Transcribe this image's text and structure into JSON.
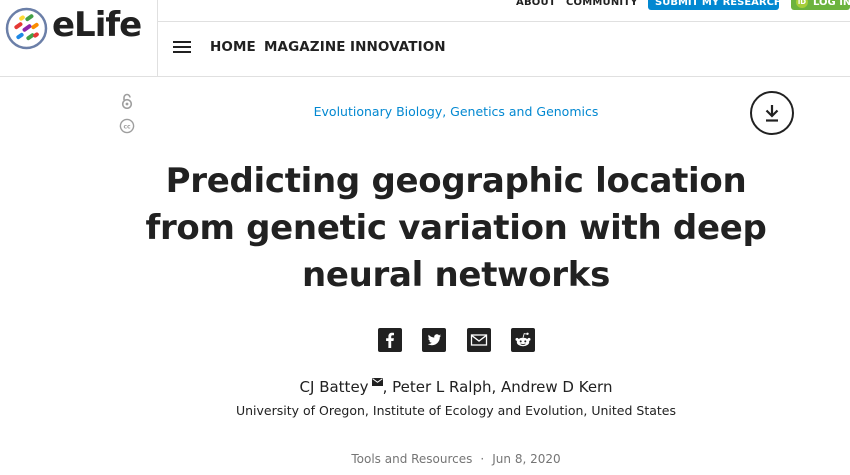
{
  "brand": {
    "logo_text": "eLife"
  },
  "topbar": {
    "about": "ABOUT",
    "community": "COMMUNITY",
    "submit": "SUBMIT MY RESEARCH",
    "login": "LOG IN",
    "submit_color": "#0288d1",
    "login_color": "#6cb33e"
  },
  "nav": {
    "menu_icon": "hamburger-menu-icon",
    "items": [
      "HOME",
      "MAGAZINE",
      "INNOVATION"
    ]
  },
  "article": {
    "subjects": "Evolutionary Biology, Genetics and Genomics",
    "title": "Predicting geographic location from genetic variation with deep neural networks",
    "authors": {
      "first": "CJ Battey",
      "rest": ", Peter L Ralph, Andrew D Kern"
    },
    "affiliation": "University of Oregon, Institute of Ecology and Evolution, United States",
    "type": "Tools and Resources",
    "separator": "·",
    "date": "Jun 8, 2020",
    "link_color": "#0288d1"
  },
  "share": [
    "facebook-icon",
    "twitter-icon",
    "email-icon",
    "reddit-icon"
  ],
  "side_icons": [
    "open-access-icon",
    "creative-commons-icon"
  ]
}
